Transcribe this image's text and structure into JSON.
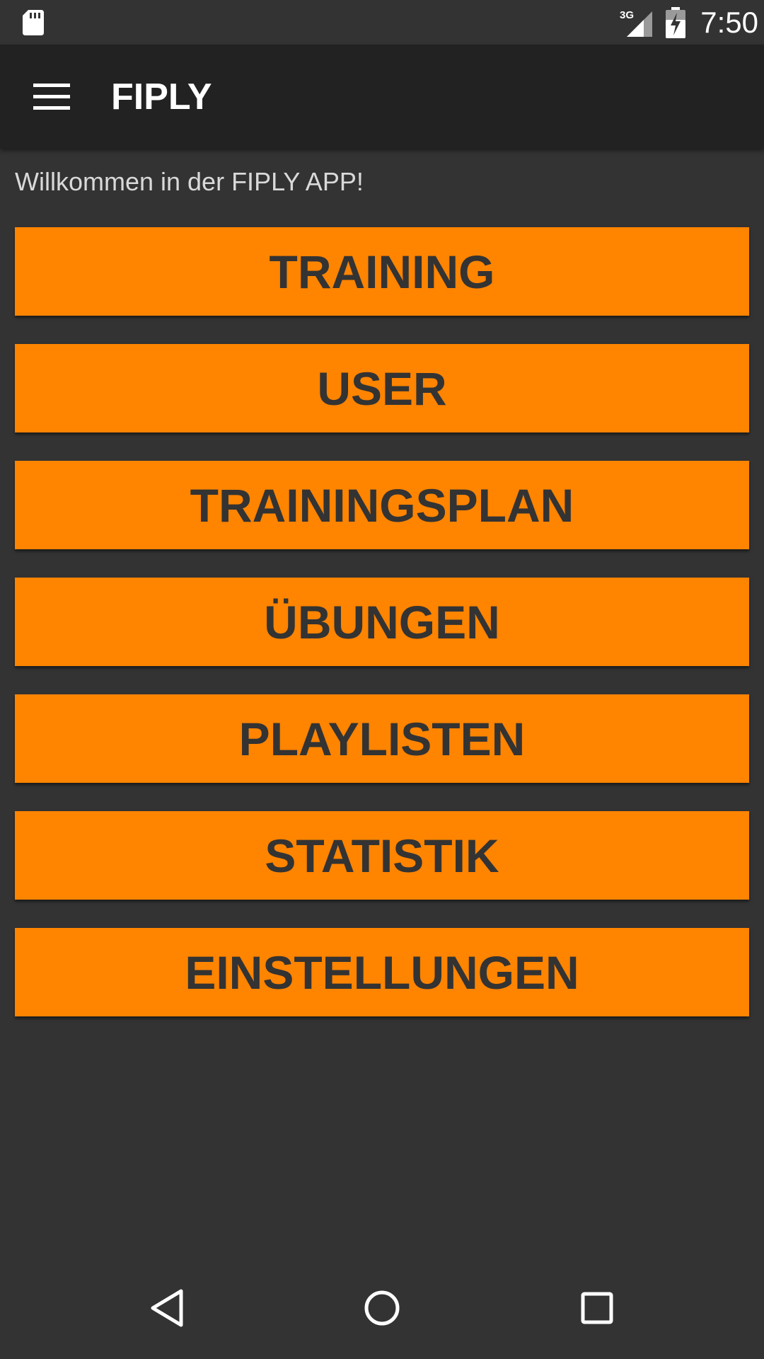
{
  "status_bar": {
    "time": "7:50",
    "network": "3G",
    "icons": [
      "sd-card-icon",
      "cell-signal-icon",
      "battery-charging-icon"
    ]
  },
  "app_bar": {
    "title": "FIPLY",
    "menu_icon": "hamburger-menu-icon"
  },
  "main": {
    "welcome_text": "Willkommen in der FIPLY APP!",
    "buttons": [
      {
        "label": "TRAINING"
      },
      {
        "label": "USER"
      },
      {
        "label": "TRAININGSPLAN"
      },
      {
        "label": "ÜBUNGEN"
      },
      {
        "label": "PLAYLISTEN"
      },
      {
        "label": "STATISTIK"
      },
      {
        "label": "EINSTELLUNGEN"
      }
    ]
  },
  "nav_bar": {
    "icons": [
      "back-icon",
      "home-icon",
      "recents-icon"
    ]
  },
  "colors": {
    "background": "#333333",
    "app_bar": "#222222",
    "accent": "#ff8400",
    "button_text": "#333333"
  }
}
